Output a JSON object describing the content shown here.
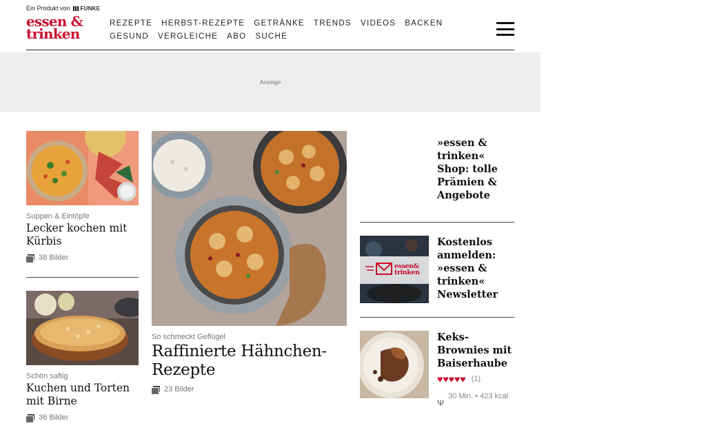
{
  "header": {
    "product_of": "Ein Produkt von",
    "publisher": "FUNKE",
    "logo_line1": "essen &",
    "logo_line2": "trinken",
    "nav": [
      "REZEPTE",
      "HERBST-REZEPTE",
      "GETRÄNKE",
      "TRENDS",
      "VIDEOS",
      "BACKEN",
      "GESUND",
      "VERGLEICHE",
      "ABO",
      "SUCHE"
    ],
    "menu_icon": "hamburger-menu-icon"
  },
  "ad": {
    "label": "Anzeige"
  },
  "left_teasers": [
    {
      "kicker": "Suppen & Eintöpfe",
      "title": "Lecker kochen mit Kürbis",
      "count": "38 Bilder"
    },
    {
      "kicker": "Schön saftig",
      "title": "Kuchen und Torten mit Birne",
      "count": "36 Bilder"
    }
  ],
  "main_teaser": {
    "kicker": "So schmeckt Geflügel",
    "title": "Raffinierte Hähnchen-Rezepte",
    "count": "23 Bilder"
  },
  "side": {
    "shop_title": "»essen & trinken« Shop: tolle Prämien & Angebote",
    "newsletter_title": "Kostenlos anmelden: »essen & trinken« Newsletter",
    "newsletter_logo_line1": "essen&",
    "newsletter_logo_line2": "trinken",
    "recipe": {
      "title": "Keks-Brownies mit Baiserhaube",
      "hearts": "♥♥♥♥♥",
      "rating_count": "(1)",
      "time": "30 Min.",
      "separator": "•",
      "kcal": "423 kcal"
    }
  },
  "colors": {
    "brand_red": "#c8102e",
    "ad_bg": "#eeeeee",
    "muted_text": "#777777"
  }
}
